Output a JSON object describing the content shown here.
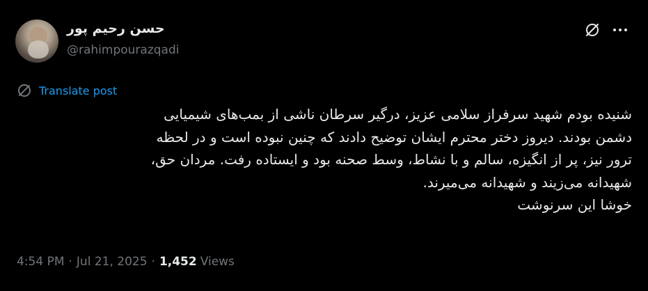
{
  "author": {
    "display_name": "حسن رحیم پور",
    "handle": "@rahimpourazqadi"
  },
  "icons": {
    "grok": "grok-icon",
    "more": "more-icon",
    "translate": "translate-globe-icon"
  },
  "translate": {
    "label": "Translate post"
  },
  "tweet": {
    "lines": [
      "شنیده بودم  شهید سرفراز سلامی عزیز، درگیر سرطان ناشی از بمب‌های شیمیایی",
      "دشمن بودند. دیروز دختر محترم ایشان  توضیح دادند که چنین نبوده است و در لحظه",
      "ترور نیز، پر از انگیزه، سالم و با نشاط، وسط صحنه بود و ایستاده رفت. مردان حق،",
      "شهیدانه می‌زیند و شهیدانه می‌میرند.",
      "خوشا این سرنوشت"
    ]
  },
  "meta": {
    "time": "4:54 PM",
    "date": "Jul 21, 2025",
    "views_count": "1,452",
    "views_label": "Views",
    "separator": "·"
  },
  "colors": {
    "background": "#000000",
    "text": "#e7e9ea",
    "secondary": "#71767b",
    "link": "#1d9bf0"
  }
}
